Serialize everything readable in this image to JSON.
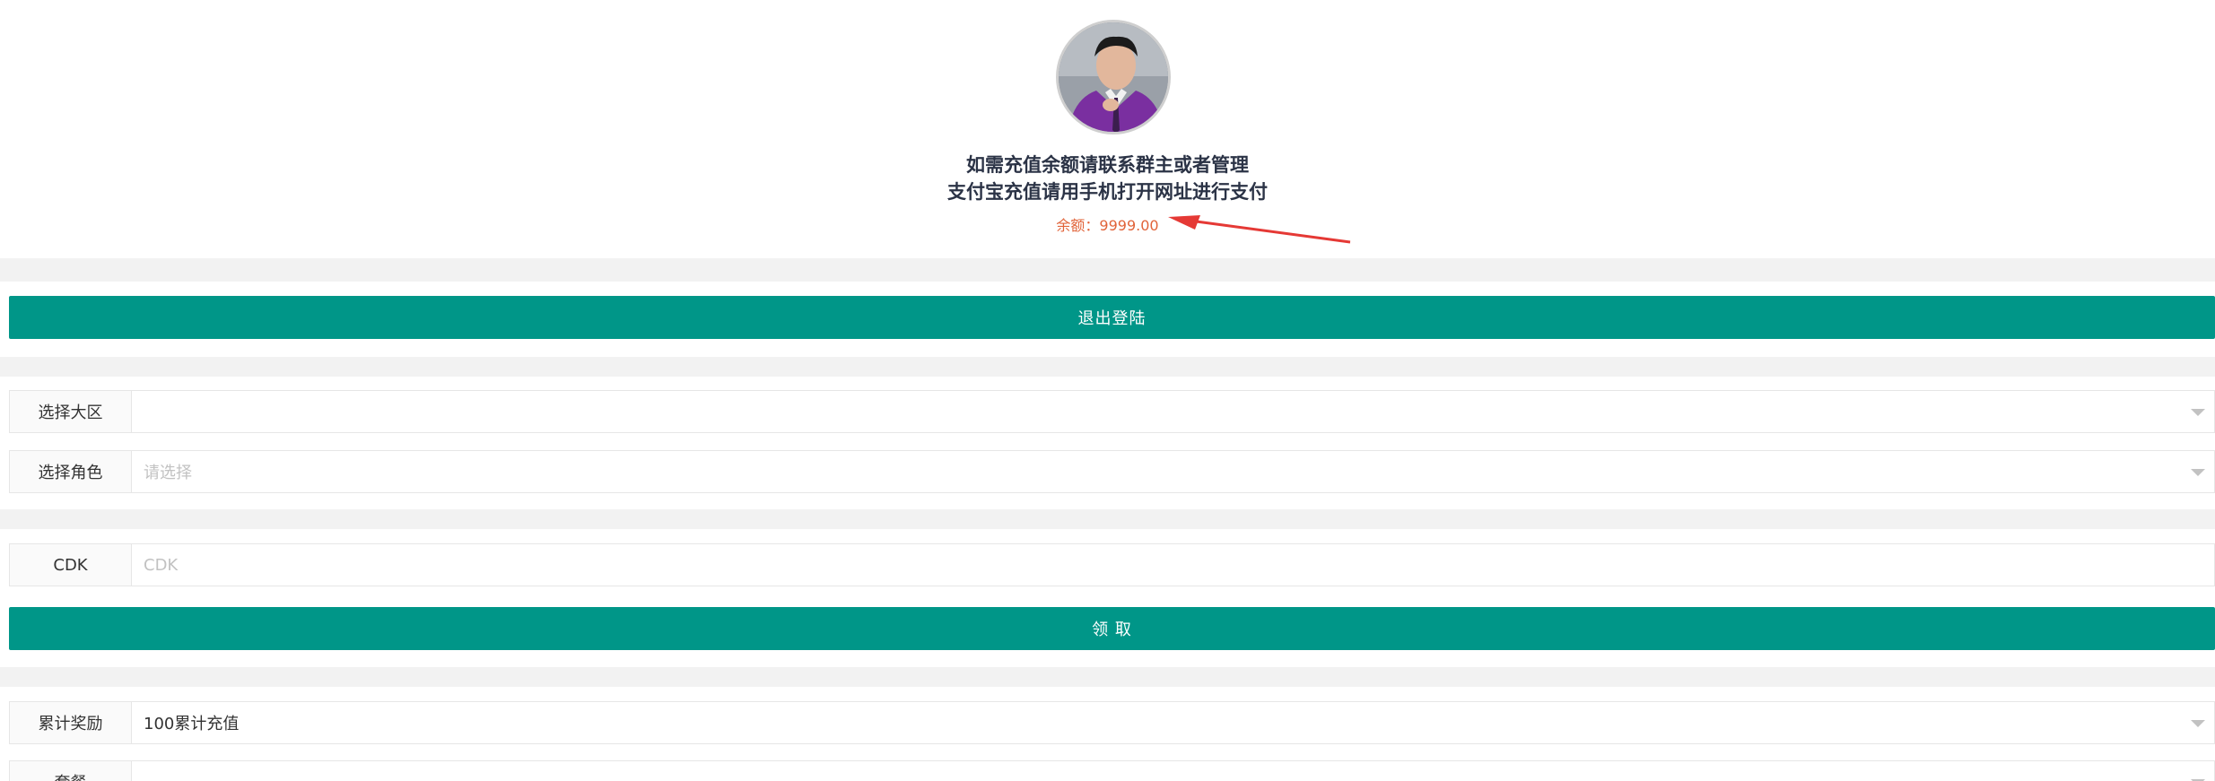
{
  "header": {
    "notice_line1": "如需充值余额请联系群主或者管理",
    "notice_line2": "支付宝充值请用手机打开网址进行支付",
    "balance_label": "余额：",
    "balance_value": "9999.00",
    "arrow_color": "#e53935"
  },
  "logout": {
    "label": "退出登陆"
  },
  "selects": {
    "region": {
      "label": "选择大区",
      "value": ""
    },
    "role": {
      "label": "选择角色",
      "placeholder": "请选择"
    }
  },
  "cdk": {
    "label": "CDK",
    "placeholder": "CDK",
    "claim_label": "领 取"
  },
  "rewards": {
    "cumulative": {
      "label": "累计奖励",
      "value": "100累计充值"
    },
    "package": {
      "label": "套餐",
      "value": ""
    }
  },
  "colors": {
    "primary": "#009688",
    "balance": "#e1643a",
    "text_dark": "#2b3346"
  },
  "icons": {
    "select_caret": "chevron-down-icon",
    "annotation_arrow": "arrow-icon"
  }
}
